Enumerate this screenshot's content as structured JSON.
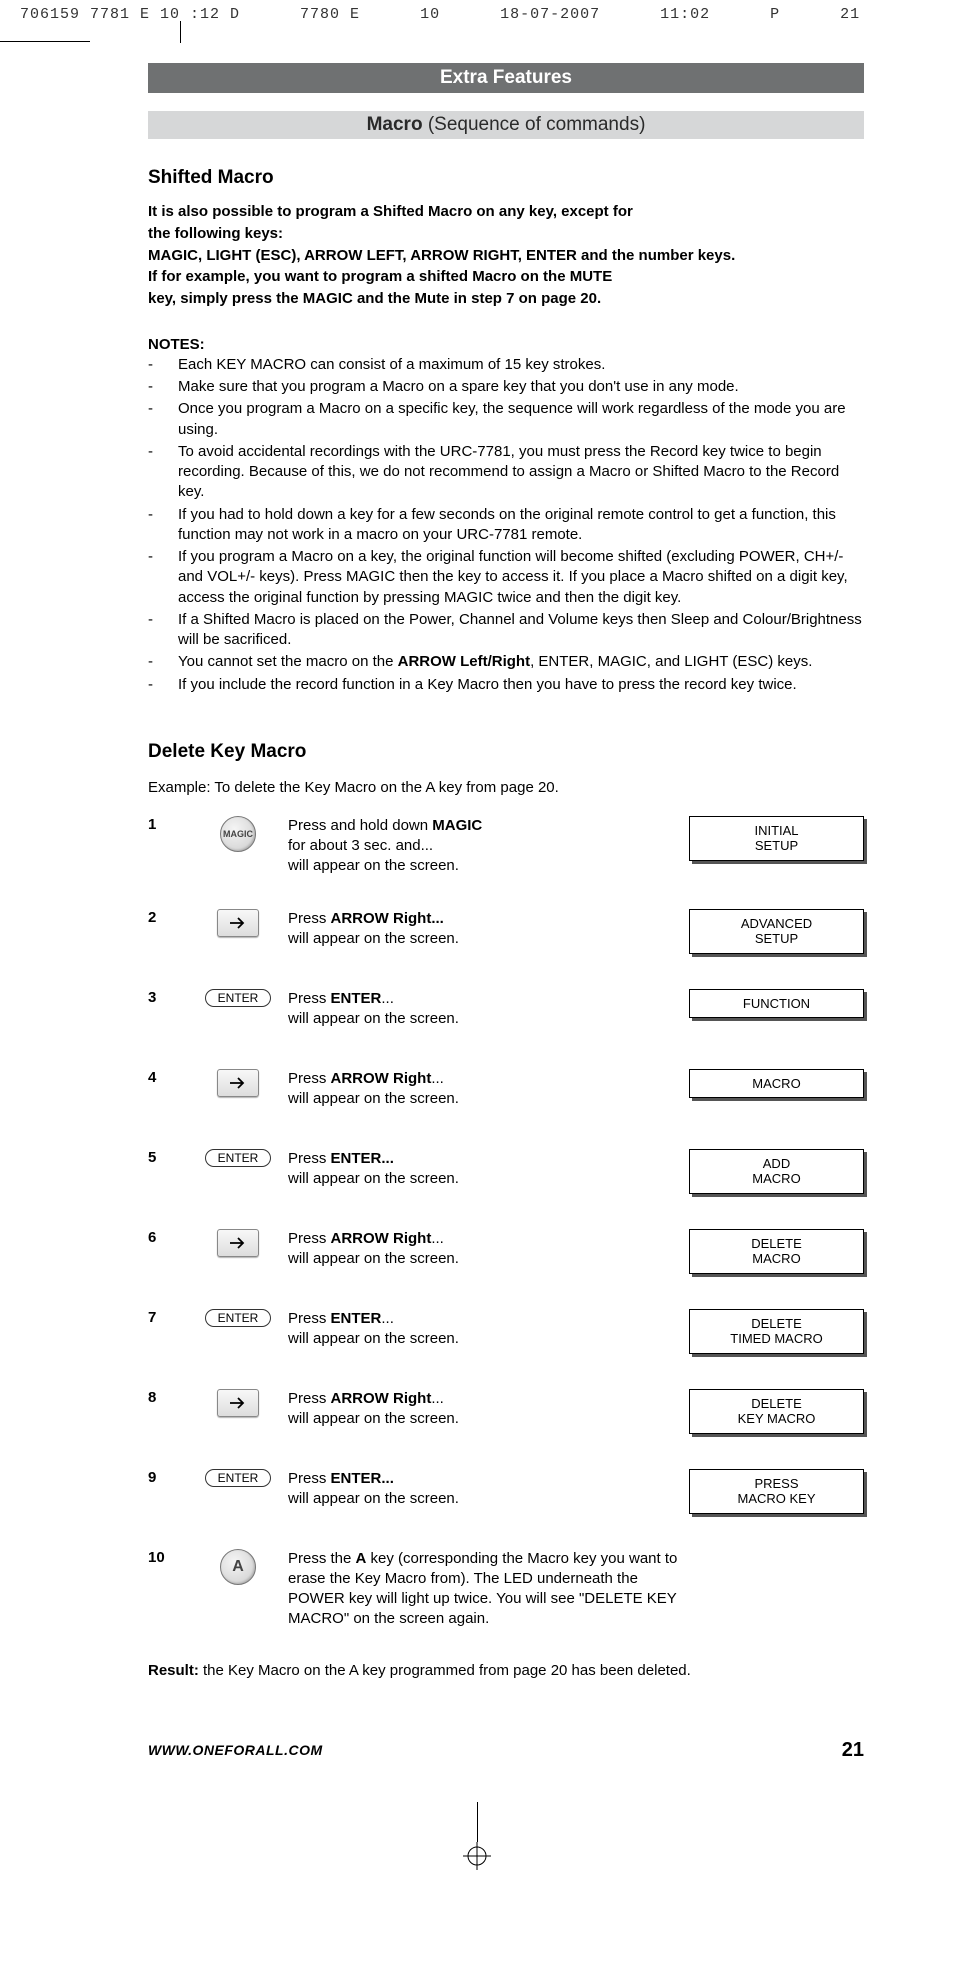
{
  "print_header": {
    "left": "706159 7781 E 10 :12 D",
    "mid1": "7780 E",
    "mid2": "10",
    "date": "18-07-2007",
    "time": "11:02",
    "p": "P",
    "num": "21"
  },
  "bands": {
    "extra_features": "Extra Features",
    "macro_bold": "Macro",
    "macro_rest": " (Sequence of commands)"
  },
  "shifted": {
    "heading": "Shifted Macro",
    "intro_l1": "It is also possible to program a Shifted Macro on any key, except for",
    "intro_l2": "the following keys:",
    "intro_l3": "MAGIC, LIGHT (ESC), ARROW LEFT, ARROW RIGHT, ENTER and the number keys.",
    "intro_l4": "If for example, you want to program a shifted Macro on the MUTE",
    "intro_l5": "key, simply press the MAGIC and the Mute in step 7 on page 20."
  },
  "notes_title": "NOTES:",
  "notes": [
    "Each KEY MACRO can consist of a maximum of 15 key strokes.",
    "Make sure that you program a Macro on a spare key that you don't use in any mode.",
    "Once you program a Macro on a specific key, the sequence will work regardless of the mode you are using.",
    "To avoid accidental recordings with the URC-7781, you must press the Record key twice to begin recording. Because of this, we do not recommend to assign a Macro or Shifted Macro to the Record key.",
    "If you had to hold down a key for a few seconds on the original remote control to get a function, this function may not work in a macro on your URC-7781 remote.",
    "If you program a Macro on a key, the original function will become shifted (excluding POWER, CH+/- and VOL+/- keys). Press MAGIC then the key to access it. If you place a Macro shifted on a digit key, access the original function by pressing MAGIC twice and then the digit key.",
    "If a Shifted Macro is placed on the Power, Channel and Volume keys then Sleep and Colour/Brightness will be sacrificed.",
    "You cannot set the macro on the <b>ARROW Left/Right</b>, ENTER, MAGIC, and LIGHT (ESC) keys.",
    "If you include the record function in a Key Macro then you have to press the record key twice."
  ],
  "delete": {
    "heading": "Delete Key Macro",
    "example": "Example: To delete the Key Macro on the A key from page 20."
  },
  "icons": {
    "magic_label": "MAGIC",
    "enter_label": "ENTER",
    "a_label": "A"
  },
  "steps": [
    {
      "num": "1",
      "icon": "magic",
      "text": "Press and hold down <b>MAGIC</b><br>for about 3 sec. and...<br>will appear on the screen.",
      "screen": "INITIAL<br>SETUP"
    },
    {
      "num": "2",
      "icon": "arrow",
      "text": "Press <b>ARROW Right...</b><br>will appear on the screen.",
      "screen": "ADVANCED<br>SETUP"
    },
    {
      "num": "3",
      "icon": "enter",
      "text": "Press <b>ENTER</b>...<br>will appear on the screen.",
      "screen": "FUNCTION"
    },
    {
      "num": "4",
      "icon": "arrow",
      "text": "Press <b>ARROW Right</b>...<br>will appear on the screen.",
      "screen": "MACRO"
    },
    {
      "num": "5",
      "icon": "enter",
      "text": "Press <b>ENTER...</b><br>will appear on the screen.",
      "screen": "ADD<br>MACRO"
    },
    {
      "num": "6",
      "icon": "arrow",
      "text": "Press <b>ARROW Right</b>...<br>will appear on the screen.",
      "screen": "DELETE<br>MACRO"
    },
    {
      "num": "7",
      "icon": "enter",
      "text": "Press <b>ENTER</b>...<br>will appear on the screen.",
      "screen": "DELETE<br>TIMED MACRO"
    },
    {
      "num": "8",
      "icon": "arrow",
      "text": "Press <b>ARROW Right</b>...<br>will appear on the screen.",
      "screen": "DELETE<br>KEY MACRO"
    },
    {
      "num": "9",
      "icon": "enter",
      "text": "Press <b>ENTER...</b><br>will appear on the screen.",
      "screen": "PRESS<br>MACRO KEY"
    },
    {
      "num": "10",
      "icon": "a",
      "text": "Press the <b>A</b> key (corresponding the Macro key you want to erase the Key Macro from). The LED underneath the POWER key will light up twice. You will see \"DELETE KEY MACRO\" on  the screen again.",
      "screen": ""
    }
  ],
  "result": "<b>Result:</b> the Key Macro on the A key programmed from page 20 has been deleted.",
  "footer": {
    "url": "WWW.ONEFORALL.COM",
    "page": "21"
  }
}
